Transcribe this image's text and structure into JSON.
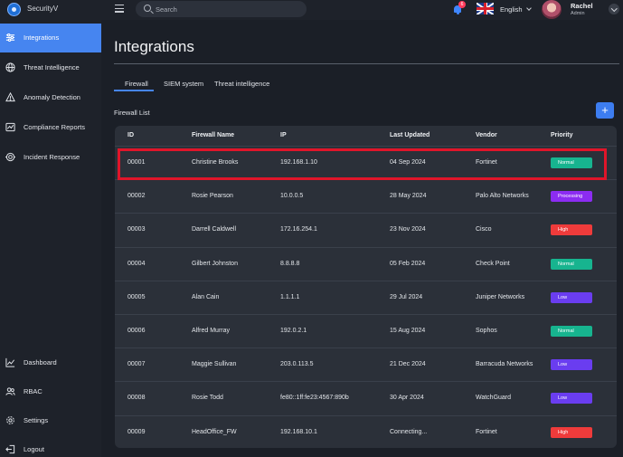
{
  "app": {
    "name": "SecurityV"
  },
  "search": {
    "placeholder": "Search"
  },
  "notifications": {
    "count": "6"
  },
  "language": {
    "selected": "English"
  },
  "user": {
    "name": "Rachel",
    "role": "Admin"
  },
  "sidebar": {
    "top_items": [
      {
        "label": "Integrations",
        "icon": "sliders-icon",
        "active": true
      },
      {
        "label": "Threat Intelligence",
        "icon": "globe-icon"
      },
      {
        "label": "Anomaly Detection",
        "icon": "warning-icon"
      },
      {
        "label": "Compliance Reports",
        "icon": "report-icon"
      },
      {
        "label": "Incident Response",
        "icon": "target-icon"
      }
    ],
    "bottom_items": [
      {
        "label": "Dashboard",
        "icon": "chart-icon"
      },
      {
        "label": "RBAC",
        "icon": "users-icon"
      },
      {
        "label": "Settings",
        "icon": "gear-icon"
      },
      {
        "label": "Logout",
        "icon": "logout-icon"
      }
    ]
  },
  "main": {
    "title": "Integrations",
    "tabs": [
      {
        "label": "Firewall",
        "active": true
      },
      {
        "label": "SIEM system"
      },
      {
        "label": "Threat intelligence"
      }
    ],
    "section_title": "Firewall List",
    "add_label": "+",
    "table": {
      "columns": [
        "ID",
        "Firewall Name",
        "IP",
        "Last Updated",
        "Vendor",
        "Priority"
      ],
      "rows": [
        {
          "id": "00001",
          "name": "Christine Brooks",
          "ip": "192.168.1.10",
          "updated": "04 Sep 2024",
          "vendor": "Fortinet",
          "priority": "Normal",
          "highlighted": true
        },
        {
          "id": "00002",
          "name": "Rosie Pearson",
          "ip": "10.0.0.5",
          "updated": "28 May 2024",
          "vendor": "Palo Alto Networks",
          "priority": "Processing"
        },
        {
          "id": "00003",
          "name": "Darrell Caldwell",
          "ip": "172.16.254.1",
          "updated": "23 Nov 2024",
          "vendor": "Cisco",
          "priority": "High"
        },
        {
          "id": "00004",
          "name": "Gilbert Johnston",
          "ip": "8.8.8.8",
          "updated": "05 Feb 2024",
          "vendor": "Check Point",
          "priority": "Normal"
        },
        {
          "id": "00005",
          "name": "Alan Cain",
          "ip": "1.1.1.1",
          "updated": "29 Jul 2024",
          "vendor": "Juniper Networks",
          "priority": "Low"
        },
        {
          "id": "00006",
          "name": "Alfred Murray",
          "ip": "192.0.2.1",
          "updated": "15 Aug 2024",
          "vendor": "Sophos",
          "priority": "Normal"
        },
        {
          "id": "00007",
          "name": "Maggie Sullivan",
          "ip": "203.0.113.5",
          "updated": "21 Dec 2024",
          "vendor": "Barracuda Networks",
          "priority": "Low"
        },
        {
          "id": "00008",
          "name": "Rosie Todd",
          "ip": "fe80::1ff:fe23:4567:890b",
          "updated": "30 Apr 2024",
          "vendor": "WatchGuard",
          "priority": "Low"
        },
        {
          "id": "00009",
          "name": "HeadOffice_FW",
          "ip": "192.168.10.1",
          "updated": "Connecting...",
          "vendor": "Fortinet",
          "priority": "High"
        }
      ]
    }
  },
  "colors": {
    "accent": "#4685f0",
    "normal": "#17b48f",
    "processing": "#8c2cf2",
    "high": "#ef3b3b",
    "low": "#6a3df0",
    "highlight_box": "#e0152a"
  }
}
